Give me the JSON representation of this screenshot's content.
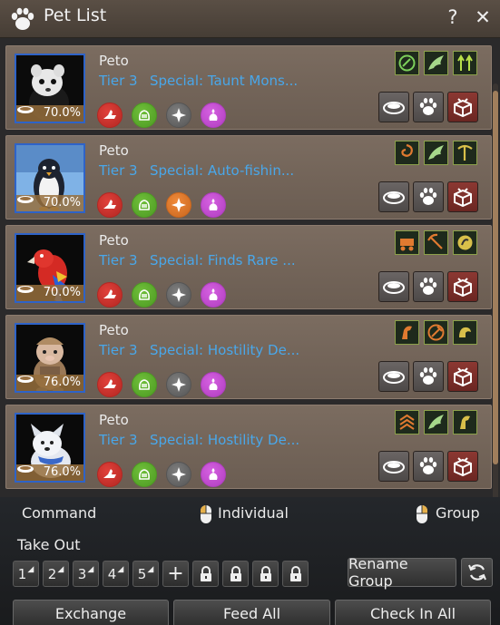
{
  "window": {
    "title": "Pet List",
    "help_glyph": "?",
    "close_glyph": "✕"
  },
  "pets": [
    {
      "name": "Peto",
      "tier": "Tier 3",
      "special": "Special: Taunt Mons...",
      "hunger": "70.0%",
      "animal": "red-panda",
      "skills": [
        "red",
        "green",
        "gray",
        "purple"
      ],
      "talents": [
        "green-circle",
        "wing",
        "arrows"
      ]
    },
    {
      "name": "Peto",
      "tier": "Tier 3",
      "special": "Special: Auto-fishin...",
      "hunger": "70.0%",
      "animal": "penguin",
      "skills": [
        "red",
        "green",
        "orange",
        "purple"
      ],
      "talents": [
        "orange-swirl",
        "wing",
        "pick"
      ]
    },
    {
      "name": "Peto",
      "tier": "Tier 3",
      "special": "Special: Finds Rare ...",
      "hunger": "70.0%",
      "animal": "parrot",
      "skills": [
        "red",
        "green",
        "gray",
        "purple"
      ],
      "talents": [
        "orange-cart",
        "orange-pick",
        "yellow-foot"
      ]
    },
    {
      "name": "Peto",
      "tier": "Tier 3",
      "special": "Special: Hostility De...",
      "hunger": "76.0%",
      "animal": "pig-soldier",
      "skills": [
        "red",
        "green",
        "gray",
        "purple"
      ],
      "talents": [
        "orange-horse",
        "orange-axe",
        "yellow-flex"
      ]
    },
    {
      "name": "Peto",
      "tier": "Tier 3",
      "special": "Special: Hostility De...",
      "hunger": "76.0%",
      "animal": "white-dog",
      "skills": [
        "red",
        "green",
        "gray",
        "purple"
      ],
      "talents": [
        "orange-chevrons",
        "wing",
        "yellow-horse"
      ]
    }
  ],
  "controls": {
    "command_label": "Command",
    "individual_label": "Individual",
    "group_label": "Group",
    "take_out_label": "Take Out",
    "slots": [
      "1",
      "2",
      "3",
      "4",
      "5"
    ],
    "add_glyph": "+",
    "rename_group_label": "Rename Group",
    "exchange_label": "Exchange",
    "feed_all_label": "Feed All",
    "check_in_all_label": "Check In All"
  },
  "colors": {
    "tier_text": "#49a7ea",
    "portrait_border": "#2e63c8",
    "store_button": "#8c3832"
  }
}
